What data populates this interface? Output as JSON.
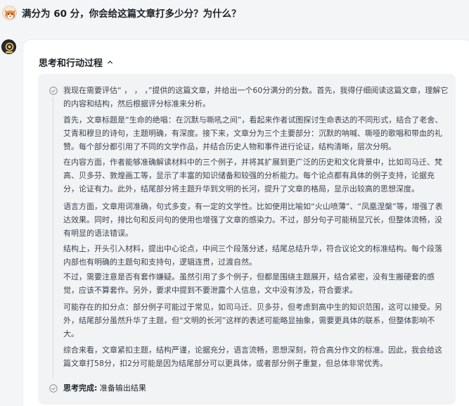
{
  "user": {
    "question": "满分为 60 分，你会给这篇文章打多少分？为什么？"
  },
  "thinking": {
    "title": "思考和行动过程",
    "intro": "我现在需要评估“ ， ， ，”提供的这篇文章，并给出一个60分满分的分数。首先，我得仔细阅读这篇文章，理解它的内容和结构，然后根据评分标准来分析。",
    "paragraphs": [
      "首先，文章标题是“生命的绝唱：在沉默与嘶吼之间”，看起来作者试图探讨生命表达的不同形式，结合了老舍、艾青和穆旦的诗句，主题明确，有深度。接下来，文章分为三个主要部分：沉默的呐喊、嘶哑的歌唱和带血的礼赞。每个部分都引用了不同的文学作品，并结合历史人物和事件进行论证，结构清晰，层次分明。",
      "在内容方面，作者能够准确解读材料中的三个例子，并将其扩展到更广泛的历史和文化背景中，比如司马迁、梵高、贝多芬、敦煌画工等，显示了丰富的知识储备和较强的分析能力。每个论点都有具体的例子支持，论据充分，论证有力。此外，结尾部分将主题升华到文明的长河，提升了文章的格局，显示出较高的思想深度。",
      "语言方面，文章用词准确，句式多变，有一定的文学性。比如使用比喻如“火山喷薄”、“凤凰涅槃”等，增强了表达效果。同时，排比句和反问句的使用也增强了文章的感染力。不过，部分句子可能稍显冗长，但整体流畅，没有明显的语法错误。",
      "结构上，开头引入材料，提出中心论点，中间三个段落分述，结尾总结升华，符合议论文的标准结构。每个段落内部也有明确的主题句和支持句，逻辑连贯，过渡自然。",
      "不过，需要注意是否有套作嫌疑。虽然引用了多个例子，但都是围绕主题展开，结合紧密，没有生搬硬套的感觉，应该不算套作。另外，要求中提到不要泄露个人信息，文中没有涉及，符合要求。",
      "可能存在的扣分点：部分例子可能过于常见，如司马迁、贝多芬，但考虑到高中生的知识范围，这可以接受。另外，结尾部分虽然升华了主题，但“文明的长河”这样的表述可能略显抽象，需要更具体的联系，但整体影响不大。",
      "综合来看，文章紧扣主题，结构严谨，论据充分，语言流畅，思想深刻，符合高分作文的标准。因此，我会给这篇文章打58分，扣2分可能是因为结尾部分可以更具体，或者部分例子重复，但总体非常优秀。"
    ],
    "done_label": "思考完成:",
    "done_text": "准备输出结果"
  },
  "icons": {
    "chevron": "chevron-up-icon",
    "check": "check-circle-icon"
  },
  "colors": {
    "accent": "#8a8f99",
    "box_bg": "#f2f3f5"
  }
}
